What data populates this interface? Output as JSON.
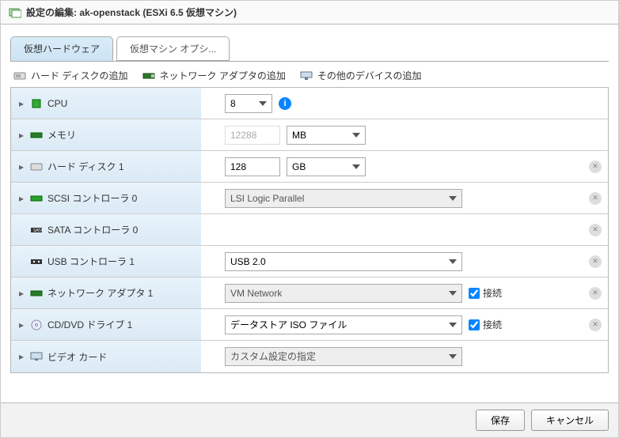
{
  "dialog_title": "設定の編集: ak-openstack (ESXi 6.5 仮想マシン)",
  "tabs": {
    "hardware": "仮想ハードウェア",
    "vmoptions": "仮想マシン オプシ..."
  },
  "toolbar": {
    "add_disk": "ハード ディスクの追加",
    "add_nic": "ネットワーク アダプタの追加",
    "add_other": "その他のデバイスの追加"
  },
  "rows": {
    "cpu": {
      "label": "CPU",
      "value": "8"
    },
    "memory": {
      "label": "メモリ",
      "value": "12288",
      "unit": "MB"
    },
    "disk": {
      "label": "ハード ディスク 1",
      "value": "128",
      "unit": "GB"
    },
    "scsi": {
      "label": "SCSI コントローラ 0",
      "value": "LSI Logic Parallel"
    },
    "sata": {
      "label": "SATA コントローラ 0"
    },
    "usb": {
      "label": "USB コントローラ 1",
      "value": "USB 2.0"
    },
    "nic": {
      "label": "ネットワーク アダプタ 1",
      "value": "VM Network",
      "connect": "接続"
    },
    "cddvd": {
      "label": "CD/DVD ドライブ 1",
      "value": "データストア ISO ファイル",
      "connect": "接続"
    },
    "video": {
      "label": "ビデオ カード",
      "value": "カスタム設定の指定"
    }
  },
  "buttons": {
    "save": "保存",
    "cancel": "キャンセル"
  }
}
